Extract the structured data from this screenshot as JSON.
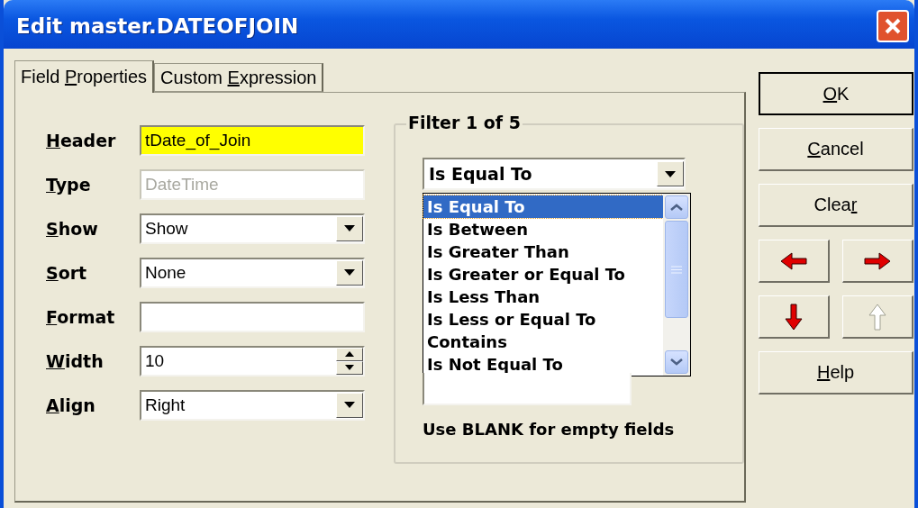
{
  "window": {
    "title": "Edit master.DATEOFJOIN"
  },
  "tabs": [
    {
      "label_parts": {
        "pre": "Field ",
        "key": "P",
        "post": "roperties"
      },
      "selected": true
    },
    {
      "label_parts": {
        "pre": "Custom ",
        "key": "E",
        "post": "xpression"
      },
      "selected": false
    }
  ],
  "fields": [
    {
      "label_parts": {
        "key": "H",
        "post": "eader"
      },
      "kind": "text",
      "value": "tDate_of_Join",
      "highlighted": true
    },
    {
      "label_parts": {
        "key": "T",
        "post": "ype"
      },
      "kind": "text",
      "value": "DateTime",
      "disabled": true
    },
    {
      "label_parts": {
        "key": "S",
        "post": "how"
      },
      "kind": "select",
      "value": "Show"
    },
    {
      "label_parts": {
        "key": "S",
        "post": "ort"
      },
      "kind": "select",
      "value": "None"
    },
    {
      "label_parts": {
        "key": "F",
        "post": "ormat"
      },
      "kind": "text"
    },
    {
      "label_parts": {
        "key": "W",
        "post": "idth"
      },
      "kind": "spin",
      "value": "10"
    },
    {
      "label_parts": {
        "key": "A",
        "post": "lign"
      },
      "kind": "select",
      "value": "Right"
    }
  ],
  "filter": {
    "title": "Filter 1 of 5",
    "operator": "Is Equal To",
    "options": [
      {
        "label": "Is Equal To",
        "selected": true
      },
      {
        "label": "Is Between",
        "selected": false
      },
      {
        "label": "Is Greater Than",
        "selected": false
      },
      {
        "label": "Is Greater or Equal To",
        "selected": false
      },
      {
        "label": "Is Less Than",
        "selected": false
      },
      {
        "label": "Is Less or Equal To",
        "selected": false
      },
      {
        "label": "Contains",
        "selected": false
      },
      {
        "label": "Is Not Equal To",
        "selected": false
      }
    ],
    "hint": "Use BLANK for empty fields"
  },
  "buttons": [
    {
      "label_parts": {
        "key": "O",
        "post": "K"
      },
      "default": true
    },
    {
      "label_parts": {
        "key": "C",
        "post": "ancel"
      },
      "default": false
    },
    {
      "label_parts": {
        "pre": "Clea",
        "key": "r"
      },
      "default": false
    }
  ],
  "arrow_buttons": [
    {
      "kind": "left",
      "disabled": false
    },
    {
      "kind": "right",
      "disabled": false
    },
    {
      "kind": "down",
      "disabled": false
    },
    {
      "kind": "up",
      "disabled": true
    }
  ],
  "help_button": {
    "label_parts": {
      "key": "H",
      "post": "elp"
    }
  }
}
